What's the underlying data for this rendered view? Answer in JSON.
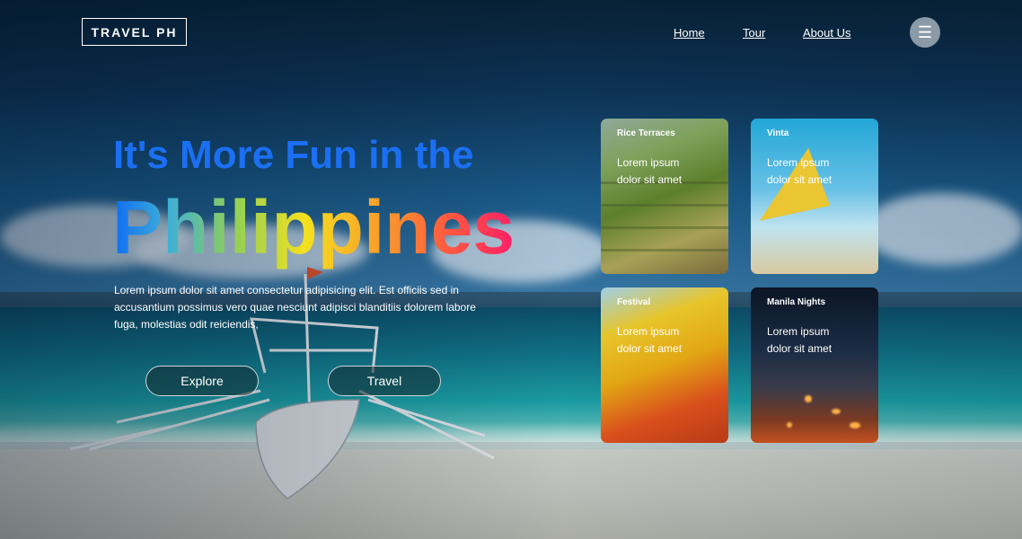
{
  "header": {
    "logo": "TRAVEL PH",
    "nav": [
      "Home",
      "Tour",
      "About Us"
    ],
    "menu_icon": "hamburger-icon"
  },
  "hero": {
    "title_top": "It's More Fun in the",
    "title_main": "Philippines",
    "description": "Lorem ipsum dolor sit amet consectetur adipisicing elit. Est officiis sed in accusantium possimus vero quae nesciunt adipisci blanditiis dolorem labore fuga, molestias odit reiciendis,",
    "buttons": [
      "Explore",
      "Travel"
    ]
  },
  "cards": [
    {
      "title": "Rice Terraces",
      "text": "Lorem ipsum dolor sit amet"
    },
    {
      "title": "Vinta",
      "text": "Lorem ipsum dolor sit amet"
    },
    {
      "title": "Festival",
      "text": "Lorem ipsum dolor sit amet"
    },
    {
      "title": "Manila Nights",
      "text": "Lorem ipsum dolor sit amet"
    }
  ],
  "colors": {
    "hero_top": "#1b6ff3",
    "gradient": [
      "#0f6cf2",
      "#8fcf57",
      "#f4e01f",
      "#f8a02a",
      "#ff1f66"
    ]
  }
}
